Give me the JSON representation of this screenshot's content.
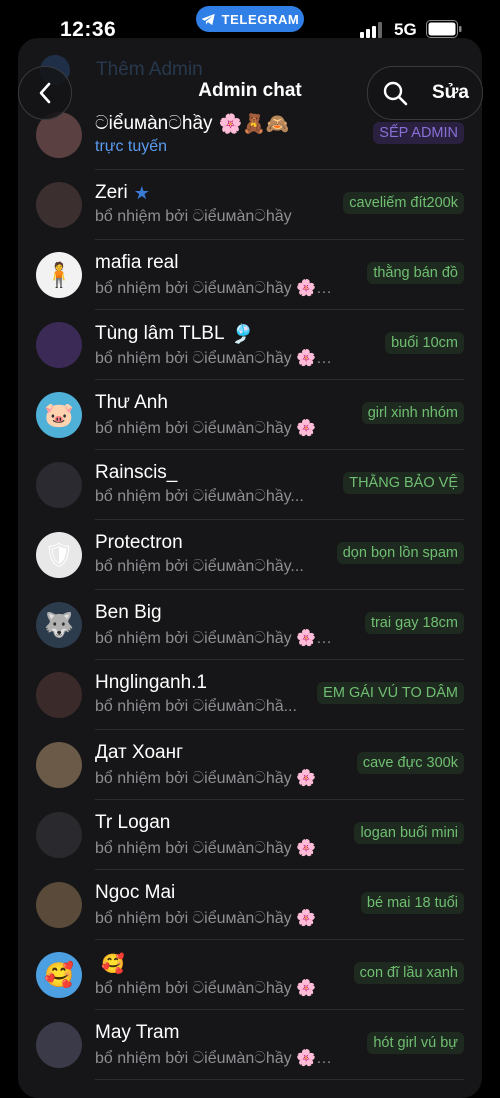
{
  "status": {
    "time": "12:36",
    "telegram_label": "TELEGRAM",
    "network": "5G"
  },
  "ghost": {
    "label": "Thêm Admin"
  },
  "header": {
    "title": "Admin chat",
    "edit_label": "Sửa"
  },
  "colors": {
    "accent": "#5b9cf0",
    "badge_green": "#6fbe72",
    "badge_owner": "#8a6fd6",
    "telegram_pill": "#2f7fe6"
  },
  "members": [
    {
      "name": "ටiểuᴍànටhầy",
      "emoji": "🌸🧸🙈",
      "sub": "trực tuyến",
      "online": true,
      "badge": "SẾP ADMIN",
      "owner": true,
      "avatar_color": "#5a4040",
      "avatar_emoji": ""
    },
    {
      "name": "Zeri",
      "emoji": "",
      "star": true,
      "sub": "bổ nhiệm bởi ටiểuᴍànටhầy",
      "badge": "caveliếm đít200k",
      "avatar_color": "#3b2f2f",
      "avatar_emoji": ""
    },
    {
      "name": "mafia real",
      "emoji": "",
      "sub": "bổ nhiệm bởi ටiểuᴍànටhầy 🌸🧸",
      "badge": "thằng bán đồ",
      "avatar_color": "#f2f2f2",
      "avatar_emoji": "🧍"
    },
    {
      "name": "Tùng lâm TLBL",
      "emoji": "🎐",
      "sub": "bổ nhiệm bởi ටiểuᴍànටhầy 🌸🧸",
      "badge": "buổi 10cm",
      "avatar_color": "#3a2a55",
      "avatar_emoji": ""
    },
    {
      "name": "Thư Anh",
      "emoji": "",
      "sub": "bổ nhiệm bởi ටiểuᴍànටhầy 🌸",
      "badge": "girl xinh nhóm",
      "avatar_color": "#4fb0d8",
      "avatar_emoji": "🐷"
    },
    {
      "name": "Rainscis_",
      "emoji": "",
      "sub": "bổ nhiệm bởi ටiểuᴍànටhầy...",
      "badge": "THẰNG BẢO VỆ",
      "avatar_color": "#2a2a30",
      "avatar_emoji": ""
    },
    {
      "name": "Protectron",
      "emoji": "",
      "sub": "bổ nhiệm bởi ටiểuᴍànටhầy...",
      "badge": "dọn bọn lồn spam",
      "avatar_color": "#e8e8e8",
      "avatar_emoji": "🛡"
    },
    {
      "name": "Ben Big",
      "emoji": "",
      "sub": "bổ nhiệm bởi ටiểuᴍànටhầy 🌸🧸",
      "badge": "trai gay 18cm",
      "avatar_color": "#2d3c4d",
      "avatar_emoji": "🐺"
    },
    {
      "name": "Hnglinganh.1",
      "emoji": "",
      "sub": "bổ nhiệm bởi ටiểuᴍànටhầ...",
      "badge": "EM GÁI VÚ TO DÂM",
      "avatar_color": "#3a2a2a",
      "avatar_emoji": ""
    },
    {
      "name": "Дат Хоанг",
      "emoji": "",
      "sub": "bổ nhiệm bởi ටiểuᴍànටhầy 🌸",
      "badge": "cave đực 300k",
      "avatar_color": "#6b5a48",
      "avatar_emoji": ""
    },
    {
      "name": "Tr Logan",
      "emoji": "",
      "sub": "bổ nhiệm bởi ටiểuᴍànටhầy 🌸",
      "badge": "logan buổi mini",
      "avatar_color": "#2a2a2e",
      "avatar_emoji": ""
    },
    {
      "name": "Ngoc Mai",
      "emoji": "",
      "sub": "bổ nhiệm bởi ටiểuᴍànටhầy 🌸",
      "badge": "bé mai 18 tuổi",
      "avatar_color": "#5a4a3a",
      "avatar_emoji": ""
    },
    {
      "name": "",
      "emoji": "🥰",
      "sub": "bổ nhiệm bởi ටiểuᴍànටhầy 🌸",
      "badge": "con đĩ lầu xanh",
      "avatar_color": "#4c9fe0",
      "avatar_emoji": "🥰"
    },
    {
      "name": "May Tram",
      "emoji": "",
      "sub": "bổ nhiệm bởi ටiểuᴍànටhầy 🌸🧸",
      "badge": "hót girl vú bự",
      "avatar_color": "#3a3a48",
      "avatar_emoji": ""
    }
  ]
}
